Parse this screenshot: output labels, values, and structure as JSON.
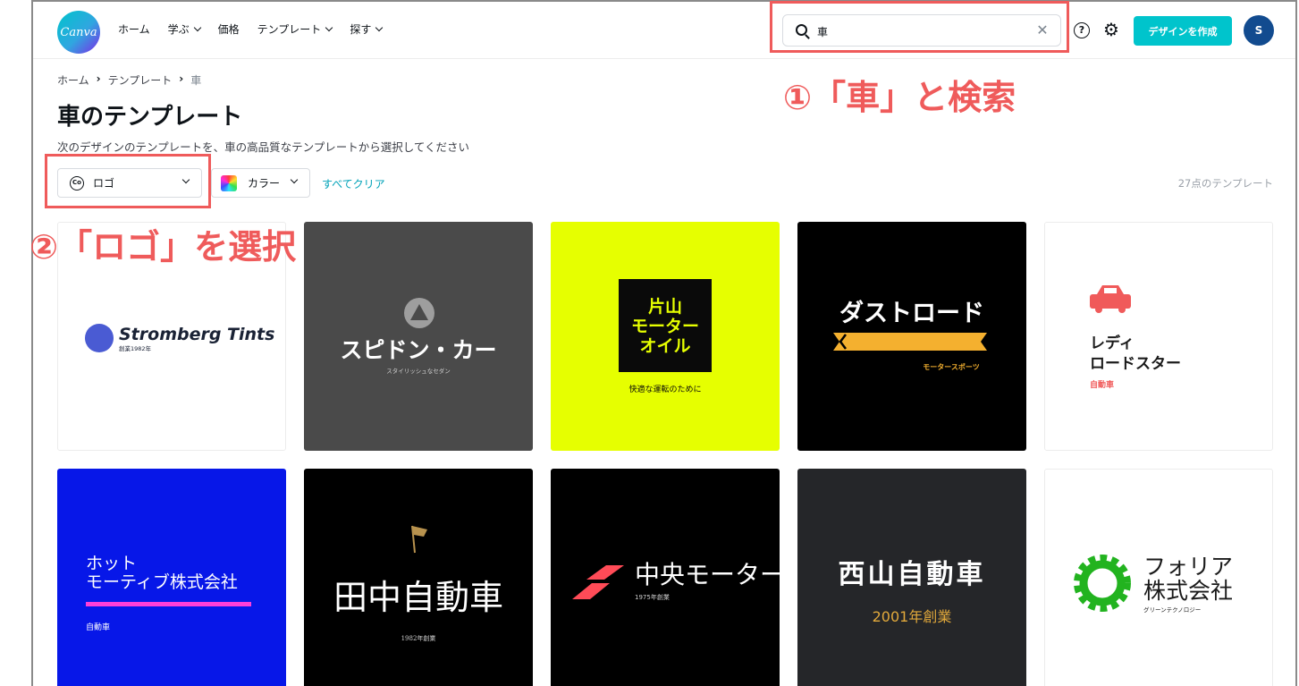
{
  "header": {
    "logo_text": "Canva",
    "nav": [
      {
        "label": "ホーム",
        "dropdown": false
      },
      {
        "label": "学ぶ",
        "dropdown": true
      },
      {
        "label": "価格",
        "dropdown": false
      },
      {
        "label": "テンプレート",
        "dropdown": true
      },
      {
        "label": "探す",
        "dropdown": true
      }
    ],
    "search_value": "車",
    "create_button": "デザインを作成",
    "avatar_initial": "S",
    "help_symbol": "?",
    "accent": "#00c4cc"
  },
  "breadcrumb": [
    "ホーム",
    "テンプレート",
    "車"
  ],
  "page": {
    "title": "車のテンプレート",
    "subtitle": "次のデザインのテンプレートを、車の高品質なテンプレートから選択してください"
  },
  "filters": {
    "type_label": "ロゴ",
    "type_icon": "Co",
    "color_label": "カラー",
    "clear_all": "すべてクリア",
    "count": "27点のテンプレート"
  },
  "annotations": {
    "search": "①「車」と検索",
    "logo": "②「ロゴ」を選択",
    "color": "#ef5b5b"
  },
  "templates": [
    {
      "title": "Stromberg Tints",
      "sub": "創業1982年"
    },
    {
      "title": "スピドン・カー",
      "sub": "スタイリッシュなセダン"
    },
    {
      "title_lines": [
        "片山",
        "モーター",
        "オイル"
      ],
      "sub": "快適な運転のために"
    },
    {
      "title": "ダストロード",
      "sub": "モータースポーツ"
    },
    {
      "title_lines": [
        "レディ",
        "ロードスター"
      ],
      "sub": "自動車"
    },
    {
      "title_lines": [
        "ホット",
        "モーティブ株式会社"
      ],
      "sub": "自動車"
    },
    {
      "title": "田中自動車",
      "sub": "1982年創業"
    },
    {
      "title": "中央モーター",
      "sub": "1975年創業"
    },
    {
      "title": "西山自動車",
      "sub": "2001年創業"
    },
    {
      "title_lines": [
        "フォリア",
        "株式会社"
      ],
      "sub": "グリーンテクノロジー"
    }
  ]
}
